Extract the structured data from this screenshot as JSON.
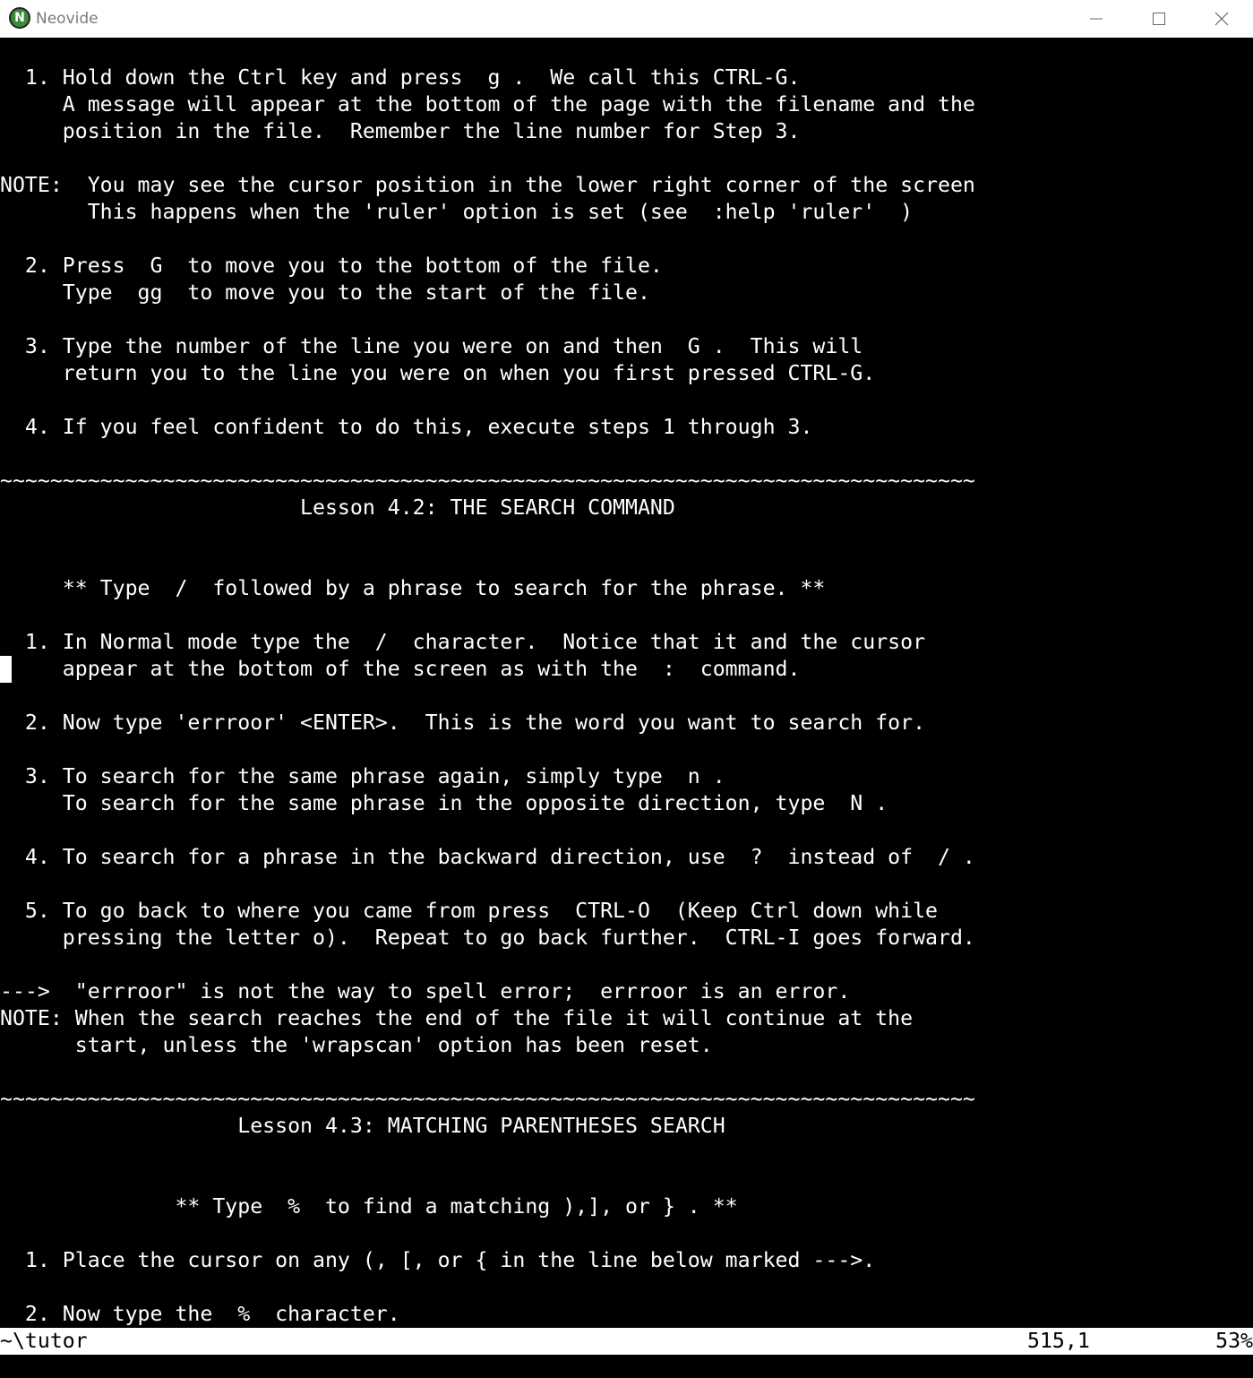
{
  "window": {
    "title": "Neovide",
    "icon_letter": "N",
    "icon": "neovide-icon",
    "controls": [
      "minimize-icon",
      "maximize-icon",
      "close-icon"
    ]
  },
  "buffer": {
    "lines": [
      "",
      "  1. Hold down the Ctrl key and press  g .  We call this CTRL-G.",
      "     A message will appear at the bottom of the page with the filename and the",
      "     position in the file.  Remember the line number for Step 3.",
      "",
      "NOTE:  You may see the cursor position in the lower right corner of the screen",
      "       This happens when the 'ruler' option is set (see  :help 'ruler'  )",
      "",
      "  2. Press  G  to move you to the bottom of the file.",
      "     Type  gg  to move you to the start of the file.",
      "",
      "  3. Type the number of the line you were on and then  G .  This will",
      "     return you to the line you were on when you first pressed CTRL-G.",
      "",
      "  4. If you feel confident to do this, execute steps 1 through 3.",
      "",
      "~~~~~~~~~~~~~~~~~~~~~~~~~~~~~~~~~~~~~~~~~~~~~~~~~~~~~~~~~~~~~~~~~~~~~~~~~~~~~~",
      "                        Lesson 4.2: THE SEARCH COMMAND",
      "",
      "",
      "     ** Type  /  followed by a phrase to search for the phrase. **",
      "",
      "  1. In Normal mode type the  /  character.  Notice that it and the cursor",
      "     appear at the bottom of the screen as with the  :  command.",
      "",
      "  2. Now type 'errroor' <ENTER>.  This is the word you want to search for.",
      "",
      "  3. To search for the same phrase again, simply type  n .",
      "     To search for the same phrase in the opposite direction, type  N .",
      "",
      "  4. To search for a phrase in the backward direction, use  ?  instead of  / .",
      "",
      "  5. To go back to where you came from press  CTRL-O  (Keep Ctrl down while",
      "     pressing the letter o).  Repeat to go back further.  CTRL-I goes forward.",
      "",
      "--->  \"errroor\" is not the way to spell error;  errroor is an error.",
      "NOTE: When the search reaches the end of the file it will continue at the",
      "      start, unless the 'wrapscan' option has been reset.",
      "",
      "~~~~~~~~~~~~~~~~~~~~~~~~~~~~~~~~~~~~~~~~~~~~~~~~~~~~~~~~~~~~~~~~~~~~~~~~~~~~~~",
      "                   Lesson 4.3: MATCHING PARENTHESES SEARCH",
      "",
      "",
      "              ** Type  %  to find a matching ),], or } . **",
      "",
      "  1. Place the cursor on any (, [, or { in the line below marked --->.",
      "",
      "  2. Now type the  %  character."
    ]
  },
  "statusline": {
    "filename": "~\\tutor",
    "position": "515,1",
    "percent": "53%"
  },
  "colors": {
    "background": "#000000",
    "foreground": "#ffffff",
    "titlebar": "#ffffff"
  }
}
